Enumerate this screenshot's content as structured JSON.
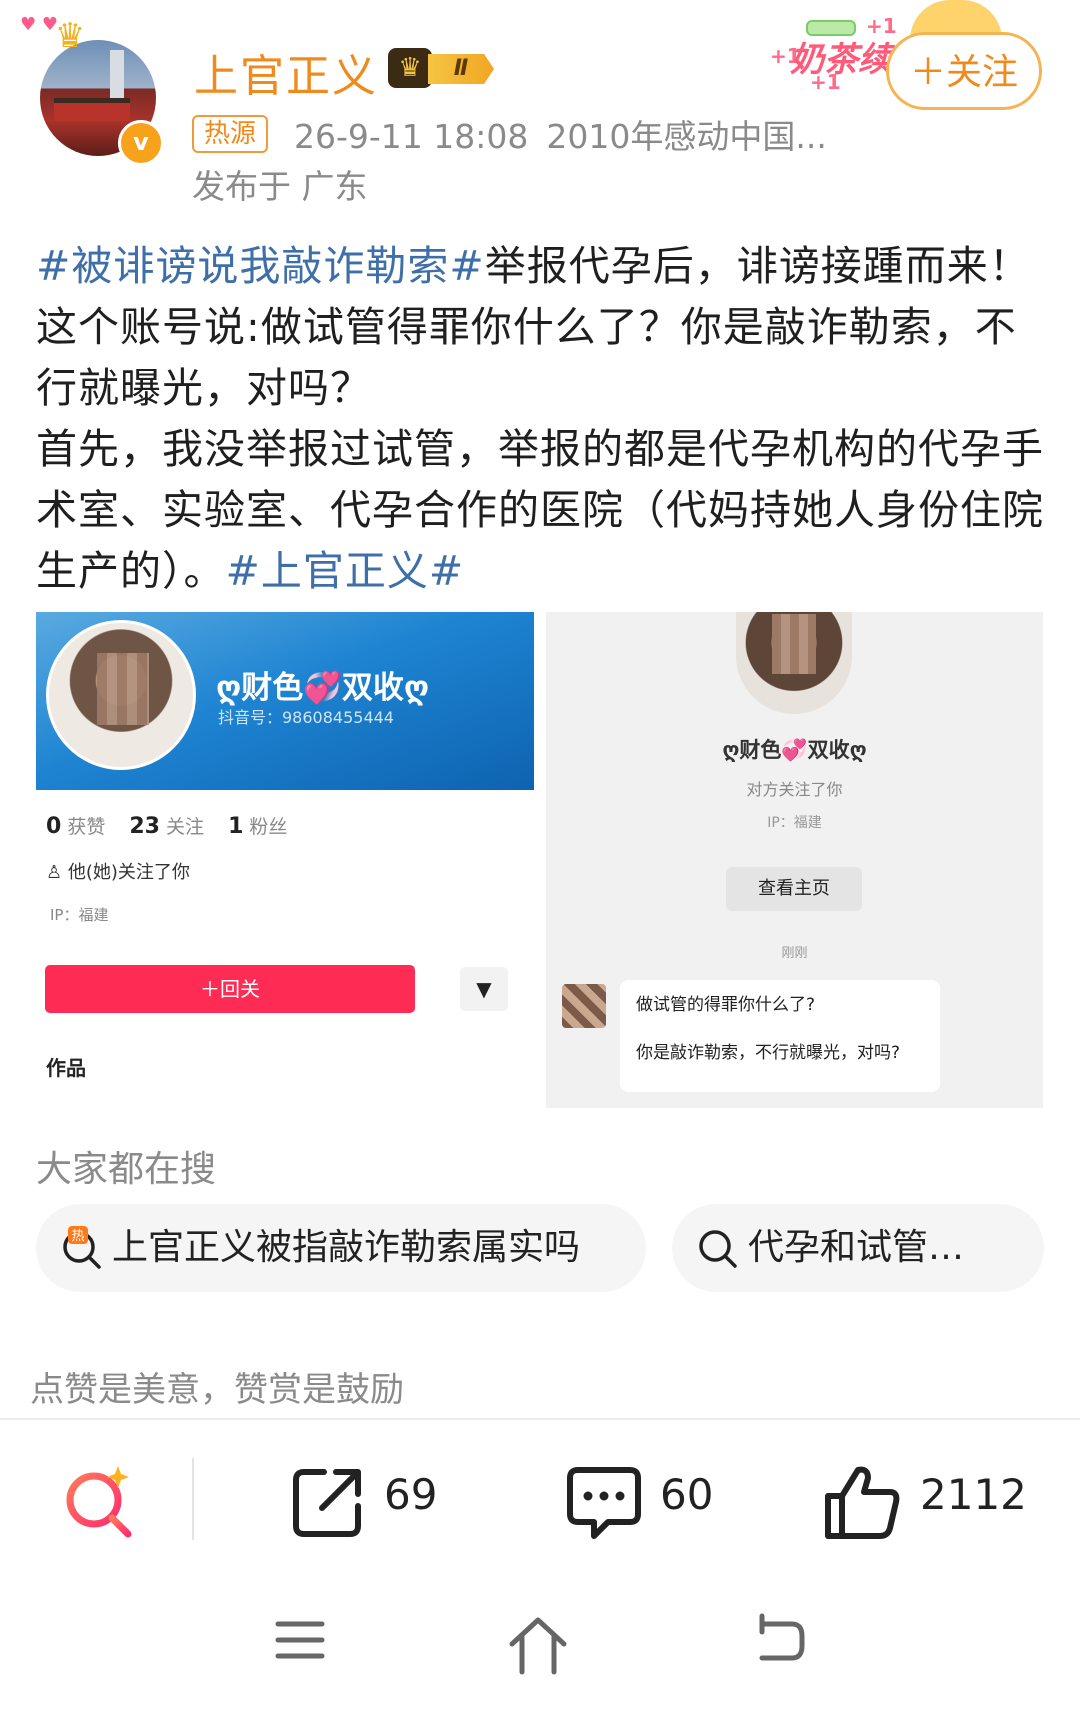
{
  "header": {
    "username": "上官正义",
    "vip_level": "Ⅱ",
    "verify_mark": "v",
    "hot_tag": "热源",
    "timestamp": "26-9-11 18:08",
    "source": "2010年感动中国...",
    "location": "发布于 广东",
    "follow_label": "＋关注",
    "decoration": {
      "tea_text": "奶茶续",
      "plus_one": "+1"
    }
  },
  "post": {
    "topic1": "#被诽谤说我敲诈勒索#",
    "text1": "举报代孕后，诽谤接踵而来！这个账号说:做试管得罪你什么了？你是敲诈勒索，不行就曝光，对吗？",
    "text2": "首先，我没举报过试管，举报的都是代孕机构的代孕手术室、实验室、代孕合作的医院（代妈持她人身份住院生产的）。",
    "topic2": "#上官正义#"
  },
  "image1": {
    "nickname": "ღ财色💞双收ღ",
    "douyin_id": "抖音号：98608455444",
    "stats": [
      {
        "num": "0",
        "label": "获赞"
      },
      {
        "num": "23",
        "label": "关注"
      },
      {
        "num": "1",
        "label": "粉丝"
      }
    ],
    "follow_you": "他(她)关注了你",
    "ip": "IP：福建",
    "follow_back": "＋回关",
    "more": "▼",
    "works": "作品"
  },
  "image2": {
    "nickname": "ღ财色💞双收ღ",
    "subtitle": "对方关注了你",
    "ip": "IP：福建",
    "home_button": "查看主页",
    "time": "刚刚",
    "msg1": "做试管的得罪你什么了?",
    "msg2": "你是敲诈勒索，不行就曝光，对吗?"
  },
  "search": {
    "title": "大家都在搜",
    "chips": [
      "上官正义被指敲诈勒索属实吗",
      "代孕和试管…"
    ]
  },
  "reward_text": "点赞是美意，赞赏是鼓励",
  "actions": {
    "share_count": "69",
    "comment_count": "60",
    "like_count": "2112"
  },
  "colors": {
    "brand_orange": "#f08a1c",
    "topic_blue": "#3f6fa8",
    "douyin_red": "#fe2c55",
    "search_red": "#ff4d6d"
  }
}
